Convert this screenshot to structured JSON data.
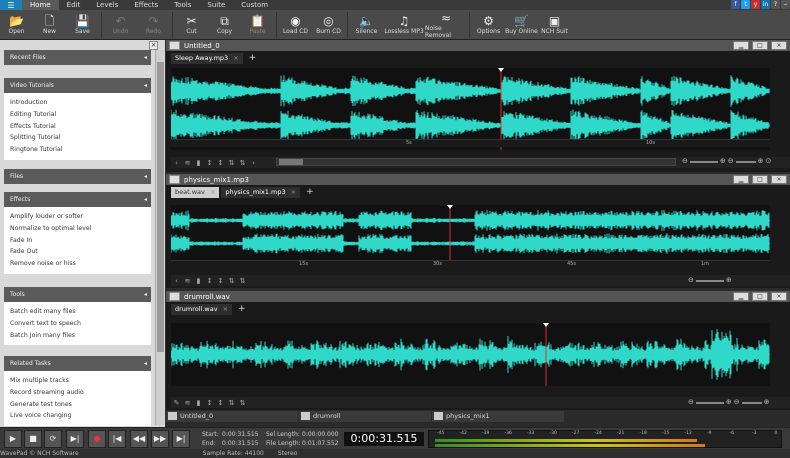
{
  "menu": {
    "items": [
      "Home",
      "Edit",
      "Levels",
      "Effects",
      "Tools",
      "Suite",
      "Custom"
    ],
    "active": "Home"
  },
  "toolbar": {
    "buttons": [
      {
        "label": "Open",
        "icon": "folder-open-icon"
      },
      {
        "label": "New",
        "icon": "new-file-icon"
      },
      {
        "label": "Save",
        "icon": "save-icon"
      },
      {
        "label": "Undo",
        "icon": "undo-icon",
        "disabled": true
      },
      {
        "label": "Redo",
        "icon": "redo-icon",
        "disabled": true
      },
      {
        "label": "Cut",
        "icon": "scissors-icon"
      },
      {
        "label": "Copy",
        "icon": "copy-icon"
      },
      {
        "label": "Paste",
        "icon": "paste-icon",
        "disabled": true
      },
      {
        "label": "Load CD",
        "icon": "cd-load-icon"
      },
      {
        "label": "Burn CD",
        "icon": "cd-burn-icon"
      },
      {
        "label": "Silence",
        "icon": "speaker-icon"
      },
      {
        "label": "Lossless MP3",
        "icon": "mp3-icon"
      },
      {
        "label": "Noise Removal",
        "icon": "noise-icon"
      },
      {
        "label": "Options",
        "icon": "tools-icon"
      },
      {
        "label": "Buy Online",
        "icon": "cart-icon"
      },
      {
        "label": "NCH Suit",
        "icon": "nch-icon"
      }
    ]
  },
  "sidebar": {
    "sections": [
      {
        "title": "Recent Files",
        "items": []
      },
      {
        "title": "Video Tutorials",
        "items": [
          "Introduction",
          "Editing Tutorial",
          "Effects Tutorial",
          "Splitting Tutorial",
          "Ringtone Tutorial"
        ]
      },
      {
        "title": "Files",
        "items": []
      },
      {
        "title": "Effects",
        "items": [
          "Amplify louder or softer",
          "Normalize to optimal level",
          "Fade In",
          "Fade Out",
          "Remove noise or hiss"
        ]
      },
      {
        "title": "Tools",
        "items": [
          "Batch edit many files",
          "Convert text to speech",
          "Batch Join many files"
        ]
      },
      {
        "title": "Related Tasks",
        "items": [
          "Mix multiple tracks",
          "Record streaming audio",
          "Generate test tones",
          "Live voice changing"
        ]
      }
    ]
  },
  "windows": [
    {
      "title": "Untitled_0",
      "tabs": [
        "Sleep Away.mp3"
      ],
      "active_tab": 0,
      "ruler": [
        "5s",
        "10s"
      ]
    },
    {
      "title": "physics_mix1.mp3",
      "tabs": [
        "beat.wav",
        "physics_mix1.mp3"
      ],
      "active_tab": 1,
      "ruler": [
        "15s",
        "30s",
        "45s",
        "1m"
      ]
    },
    {
      "title": "drumroll.wav",
      "tabs": [
        "drumroll.wav"
      ],
      "active_tab": 0,
      "ruler": []
    }
  ],
  "filetabs": [
    "Untitled_0",
    "drumroll",
    "physics_mix1"
  ],
  "transport": {
    "start_label": "Start:",
    "start": "0:00:31.515",
    "end_label": "End:",
    "end": "0:00:31.515",
    "sel_label": "Sel Length:",
    "sel": "0:00:00.000",
    "file_label": "File Length:",
    "file": "0:01:07.552",
    "time": "0:00:31.515",
    "scale": [
      "-45",
      "-42",
      "-39",
      "-36",
      "-33",
      "-30",
      "-27",
      "-24",
      "-21",
      "-18",
      "-15",
      "-12",
      "-9",
      "-6",
      "-3",
      "0"
    ]
  },
  "status": {
    "app": "WavePad © NCH Software",
    "rate": "Sample Rate: 44100",
    "mode": "Stereo"
  },
  "colors": {
    "wave": "#2fd8c8",
    "cursor": "#e03030",
    "panel": "#5a5a5a"
  }
}
